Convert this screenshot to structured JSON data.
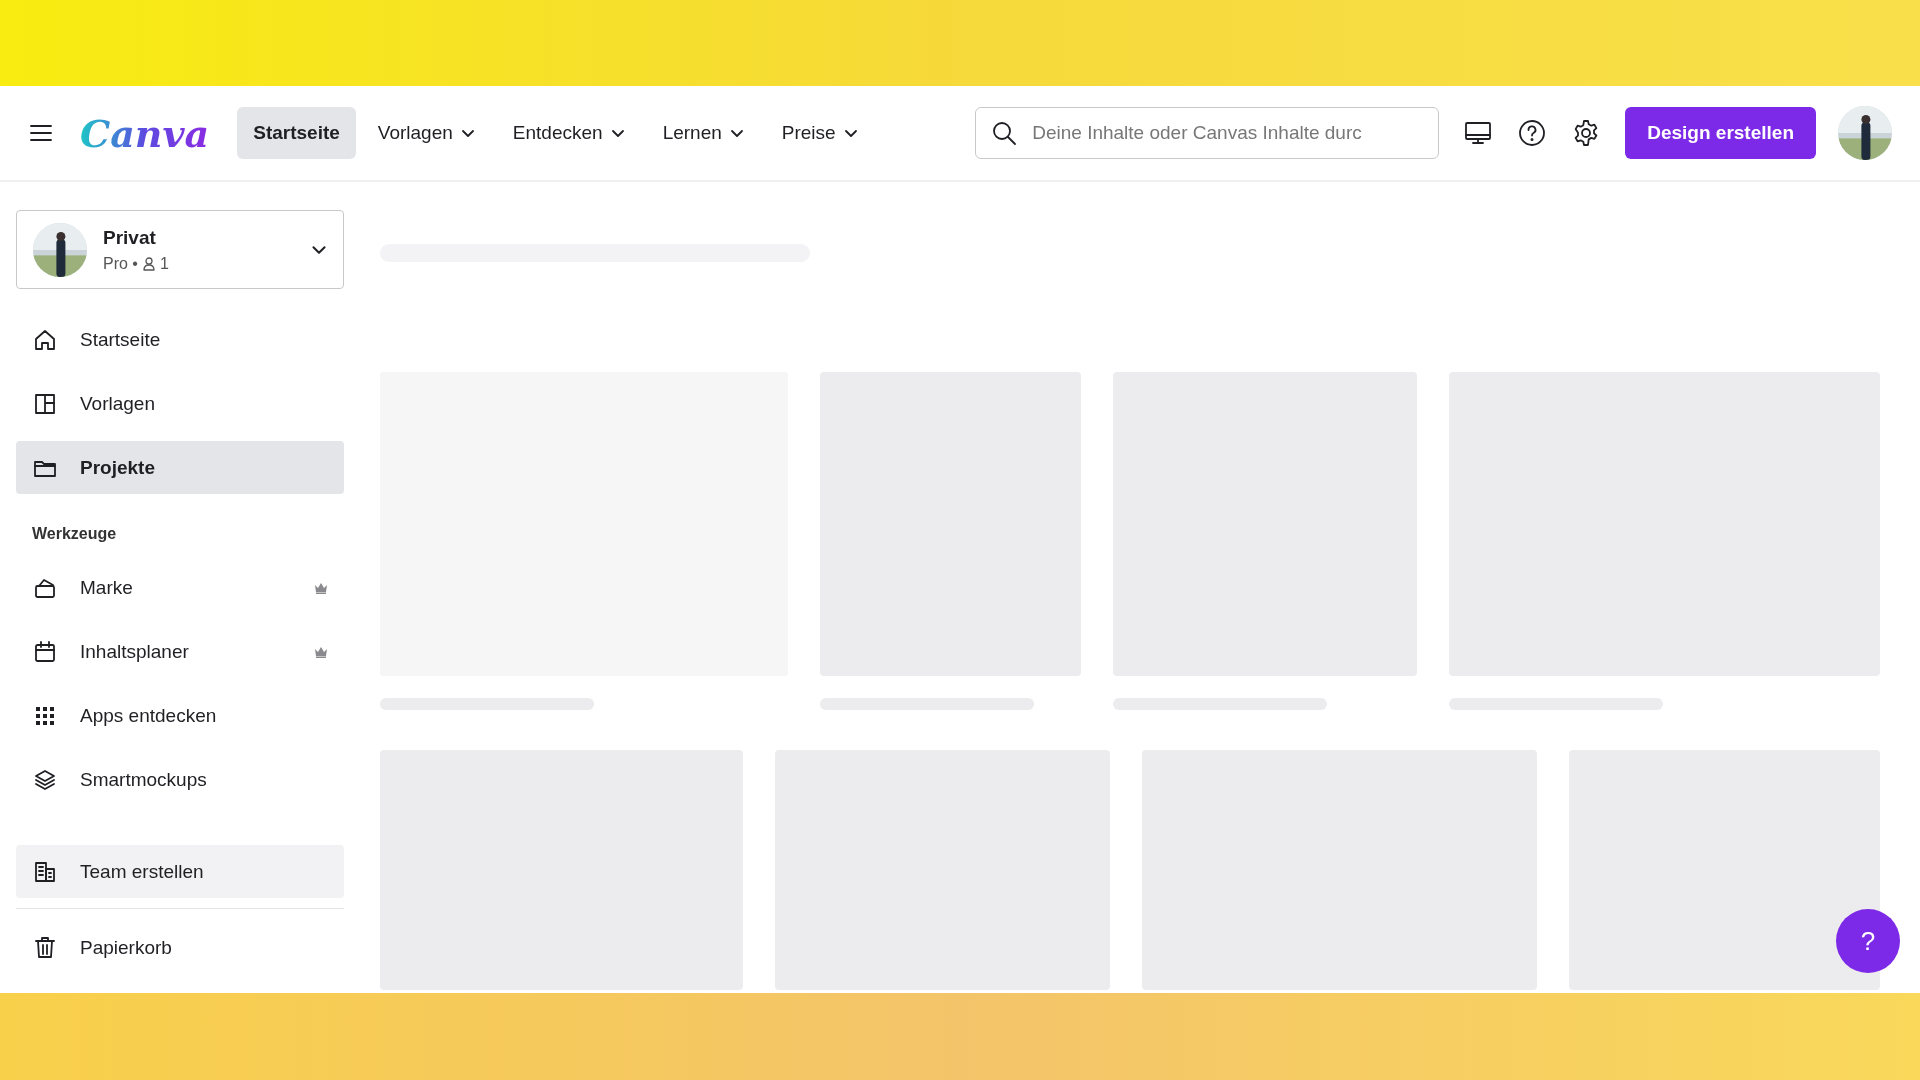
{
  "header": {
    "logo": "Canva",
    "nav": [
      {
        "label": "Startseite",
        "selected": true,
        "dropdown": false
      },
      {
        "label": "Vorlagen",
        "selected": false,
        "dropdown": true
      },
      {
        "label": "Entdecken",
        "selected": false,
        "dropdown": true
      },
      {
        "label": "Lernen",
        "selected": false,
        "dropdown": true
      },
      {
        "label": "Preise",
        "selected": false,
        "dropdown": true
      }
    ],
    "search": {
      "placeholder": "Deine Inhalte oder Canvas Inhalte durc"
    },
    "create_button": "Design erstellen"
  },
  "sidebar": {
    "account": {
      "name": "Privat",
      "plan": "Pro •",
      "members": "1"
    },
    "items": [
      {
        "label": "Startseite",
        "selected": false,
        "premium": false
      },
      {
        "label": "Vorlagen",
        "selected": false,
        "premium": false
      },
      {
        "label": "Projekte",
        "selected": true,
        "premium": false
      }
    ],
    "section_title": "Werkzeuge",
    "tools": [
      {
        "label": "Marke",
        "selected": false,
        "premium": true
      },
      {
        "label": "Inhaltsplaner",
        "selected": false,
        "premium": true
      },
      {
        "label": "Apps entdecken",
        "selected": false,
        "premium": false
      },
      {
        "label": "Smartmockups",
        "selected": false,
        "premium": false
      }
    ],
    "team_button": "Team erstellen",
    "trash": "Papierkorb"
  },
  "content": {
    "loading": true
  },
  "help_button": "?"
}
